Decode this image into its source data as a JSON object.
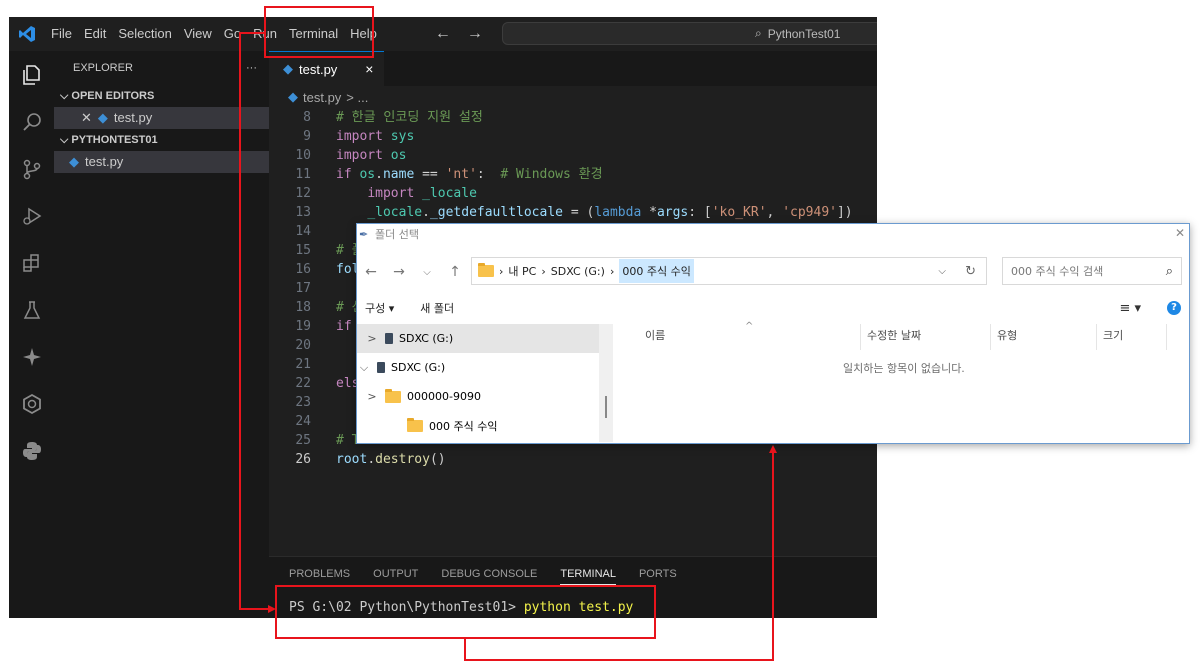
{
  "menu": [
    "File",
    "Edit",
    "Selection",
    "View",
    "Go",
    "Run",
    "Terminal",
    "Help"
  ],
  "search_title": "PythonTest01",
  "sidebar": {
    "title": "EXPLORER",
    "more": "···",
    "open_editors_label": "OPEN EDITORS",
    "open_editor_file": "test.py",
    "project_label": "PYTHONTEST01",
    "project_file": "test.py"
  },
  "tab": {
    "label": "test.py",
    "close": "×"
  },
  "breadcrumb": {
    "file": "test.py",
    "rest": "> ..."
  },
  "code_lines": [
    {
      "n": "8",
      "html": "<span class=\"cm\"># 한글 인코딩 지원 설정</span>"
    },
    {
      "n": "9",
      "html": "<span class=\"kw\">import</span> <span class=\"mod\">sys</span>"
    },
    {
      "n": "10",
      "html": "<span class=\"kw\">import</span> <span class=\"mod\">os</span>"
    },
    {
      "n": "11",
      "html": "<span class=\"kw\">if</span> <span class=\"mod\">os</span>.<span class=\"var\">name</span> <span class=\"op\">==</span> <span class=\"st\">'nt'</span>:  <span class=\"cm\"># Windows 환경</span>"
    },
    {
      "n": "12",
      "html": "    <span class=\"kw\">import</span> <span class=\"mod\">_locale</span>"
    },
    {
      "n": "13",
      "html": "    <span class=\"mod\">_locale</span>.<span class=\"var\">_getdefaultlocale</span> <span class=\"op\">=</span> (<span class=\"kb\">lambda</span> <span class=\"op\">*</span><span class=\"var\">args</span>: [<span class=\"st\">'ko_KR'</span>, <span class=\"st\">'cp949'</span>])"
    },
    {
      "n": "14",
      "html": ""
    },
    {
      "n": "15",
      "html": "<span class=\"cm\"># 폴</span>"
    },
    {
      "n": "16",
      "html": "<span class=\"var\">fol</span>"
    },
    {
      "n": "17",
      "html": ""
    },
    {
      "n": "18",
      "html": "<span class=\"cm\"># 선</span>"
    },
    {
      "n": "19",
      "html": "<span class=\"kw\">if</span>"
    },
    {
      "n": "20",
      "html": ""
    },
    {
      "n": "21",
      "html": ""
    },
    {
      "n": "22",
      "html": "<span class=\"kw\">els</span>"
    },
    {
      "n": "23",
      "html": ""
    },
    {
      "n": "24",
      "html": ""
    },
    {
      "n": "25",
      "html": "<span class=\"cm\"># T</span>"
    },
    {
      "n": "26",
      "html": "<span class=\"var\">root</span>.<span class=\"fn\">destroy</span>()"
    }
  ],
  "panel": {
    "tabs": [
      "PROBLEMS",
      "OUTPUT",
      "DEBUG CONSOLE",
      "TERMINAL",
      "PORTS"
    ],
    "active_tab": "TERMINAL",
    "prompt": "PS G:\\02 Python\\PythonTest01> ",
    "command": "python test.py"
  },
  "dialog": {
    "title": "폴더 선택",
    "address": [
      "내 PC",
      "SDXC (G:)",
      "000 주식 수익"
    ],
    "search_placeholder": "000 주식 수익 검색",
    "organize": "구성 ▾",
    "new_folder": "새 폴더",
    "tree": [
      {
        "label": "SDXC (G:)",
        "chevron": ">",
        "icon": "drive",
        "indent": 30,
        "selected": true
      },
      {
        "label": "SDXC (G:)",
        "chevron": "v",
        "icon": "drive",
        "indent": 4,
        "selected": false
      },
      {
        "label": "000000-9090",
        "chevron": ">",
        "icon": "folder",
        "indent": 30,
        "selected": false
      },
      {
        "label": "000 주식 수익",
        "chevron": "",
        "icon": "folder",
        "indent": 30,
        "selected": false
      }
    ],
    "columns": [
      "이름",
      "수정한 날짜",
      "유형",
      "크기"
    ],
    "empty_text": "일치하는 항목이 없습니다."
  }
}
